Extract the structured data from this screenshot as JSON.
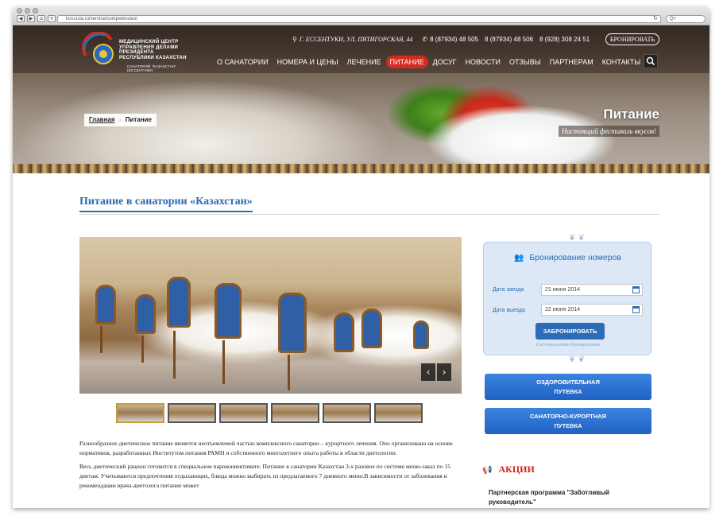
{
  "browser": {
    "url": "kcrussia.ru/service/competencies/",
    "search_placeholder": "Q+"
  },
  "header": {
    "logo": {
      "title_lines": [
        "МЕДИЦИНСКИЙ ЦЕНТР",
        "УПРАВЛЕНИЯ ДЕЛАМИ ПРЕЗИДЕНТА",
        "РЕСПУБЛИКИ КАЗАХСТАН"
      ],
      "subtitle": "САНАТОРИЙ \"КАЗАХСТАН\" (ЕССЕНТУКИ)"
    },
    "address": "Г. ЕССЕНТУКИ, УЛ. ПЯТИГОРСКАЯ, 44",
    "phones": [
      "8 (87934) 48 505",
      "8 (87934) 48 506",
      "8 (928) 308 24 51"
    ],
    "book_label": "БРОНИРОВАТЬ",
    "menu": [
      {
        "label": "О САНАТОРИИ",
        "active": false
      },
      {
        "label": "НОМЕРА И ЦЕНЫ",
        "active": false
      },
      {
        "label": "ЛЕЧЕНИЕ",
        "active": false
      },
      {
        "label": "ПИТАНИЕ",
        "active": true
      },
      {
        "label": "ДОСУГ",
        "active": false
      },
      {
        "label": "НОВОСТИ",
        "active": false
      },
      {
        "label": "ОТЗЫВЫ",
        "active": false
      },
      {
        "label": "ПАРТНЕРАМ",
        "active": false
      },
      {
        "label": "КОНТАКТЫ",
        "active": false
      }
    ]
  },
  "hero": {
    "breadcrumb": {
      "home": "Главная",
      "current": "Питание"
    },
    "title": "Питание",
    "subtitle": "Настоящий фестиваль вкусов!"
  },
  "main": {
    "title": "Питание в санатории «Казахстан»",
    "paragraphs": [
      "Разнообразное диетическое питание является неотъемлемой частью комплексного санаторно – курортного лечения. Оно организовано на основе нормативов, разработанных Институтом питания РАМН и собственного многолетнего опыта работы в области диетологии.",
      "Весь диетический рацион готовится в специальном пароконвектомате. Питание в санатории Казахстан 3-х разовое по системе меню-заказ по 15 диетам. Учитываются предпочтения отдыхающих, блюда можно выбирать из предлагаемого 7 дневного меню.В зависимости от заболевания и рекомендации врача-диетолога питание может"
    ]
  },
  "booking": {
    "title": "Бронирование номеров",
    "checkin_label": "Дата заезда",
    "checkin_value": "21 июня 2014",
    "checkout_label": "Дата выезда",
    "checkout_value": "22 июня 2014",
    "submit_label": "ЗАБРОНИРОВАТЬ",
    "footer": "Система онлайн-бронирования"
  },
  "sidebar": {
    "buttons": [
      {
        "line1": "ОЗДОРОВИТЕЛЬНАЯ",
        "line2": "ПУТЕВКА"
      },
      {
        "line1": "САНАТОРНО-КУРОРТНАЯ",
        "line2": "ПУТЕВКА"
      }
    ],
    "promo_title": "АКЦИИ",
    "promo_item": "Партнерская программа \"Заботливый руководитель\""
  }
}
